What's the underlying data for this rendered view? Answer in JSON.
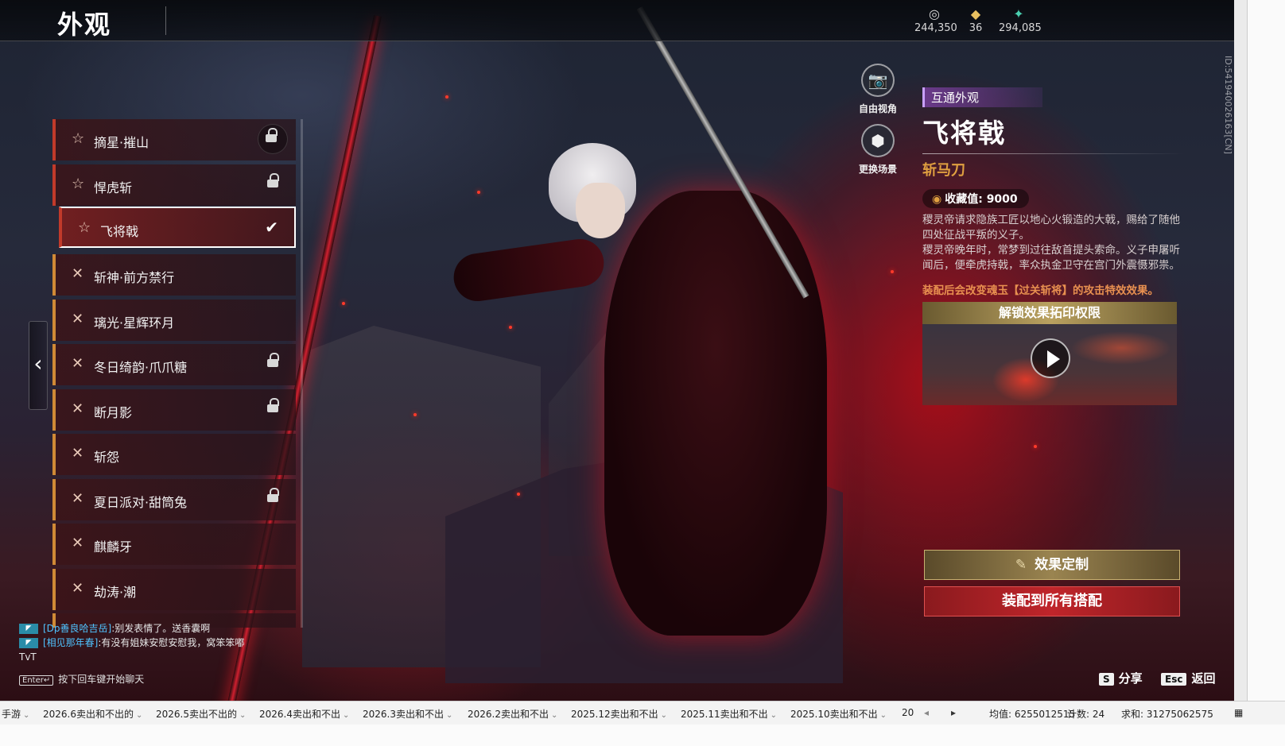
{
  "header": {
    "title": "外观",
    "currencies": [
      {
        "icon": "silver-coin-icon",
        "value": "244,350"
      },
      {
        "icon": "gold-ingot-icon",
        "value": "36"
      },
      {
        "icon": "jade-feather-icon",
        "value": "294,085"
      }
    ]
  },
  "list": {
    "items": [
      {
        "label": "摘星·摧山",
        "icon": "star",
        "locked": true,
        "accent": "red"
      },
      {
        "label": "悍虎斩",
        "icon": "star",
        "locked": true,
        "accent": "red"
      },
      {
        "label": "飞将戟",
        "icon": "star",
        "locked": false,
        "selected": true,
        "accent": "red"
      },
      {
        "label": "斩神·前方禁行",
        "icon": "cross",
        "locked": false,
        "accent": "orange"
      },
      {
        "label": "璃光·星辉环月",
        "icon": "cross",
        "locked": false,
        "accent": "orange"
      },
      {
        "label": "冬日绮韵·爪爪糖",
        "icon": "cross",
        "locked": true,
        "accent": "orange"
      },
      {
        "label": "断月影",
        "icon": "cross",
        "locked": true,
        "accent": "orange"
      },
      {
        "label": "斩怨",
        "icon": "cross",
        "locked": false,
        "accent": "orange"
      },
      {
        "label": "夏日派对·甜筒兔",
        "icon": "cross",
        "locked": true,
        "accent": "orange"
      },
      {
        "label": "麒麟牙",
        "icon": "cross",
        "locked": false,
        "accent": "orange"
      },
      {
        "label": "劫涛·潮",
        "icon": "cross",
        "locked": false,
        "accent": "orange"
      }
    ]
  },
  "camera": {
    "free_view": "自由视角",
    "change_scene": "更换场景"
  },
  "detail": {
    "tag": "互通外观",
    "name": "飞将戟",
    "type": "斩马刀",
    "collect_label": "收藏值: 9000",
    "desc1": "稷灵帝请求隐族工匠以地心火锻造的大戟，赐给了随他四处征战平叛的义子。",
    "desc2": "稷灵帝晚年时，常梦到过往敌首提头索命。义子申屠听闻后，便牵虎持戟，率众执金卫守在宫门外震慑邪祟。",
    "effect_note": "装配后会改变魂玉【过关斩将】的攻击特效效果。",
    "unlock": "解锁效果拓印权限"
  },
  "buttons": {
    "custom": "效果定制",
    "equip_all": "装配到所有搭配",
    "share_key": "S",
    "share": "分享",
    "back_key": "Esc",
    "back": "返回"
  },
  "chat": {
    "line1_name": "[Dp善良哈吉岳]",
    "line1_text": ":别发表情了。送香囊啊",
    "line2_name": "[相见那年春]",
    "line2_text": ":有没有姐妹安慰安慰我，窝笨笨嘟TvT",
    "enter_key": "Enter↵",
    "enter_hint": "按下回车键开始聊天"
  },
  "id_text": "ID:541940026163[CN]",
  "sheetbar": {
    "tabs": [
      "手游",
      "2026.6卖出和不出的",
      "2026.5卖出不出的",
      "2026.4卖出和不出",
      "2026.3卖出和不出",
      "2026.2卖出和不出",
      "2025.12卖出和不出",
      "2025.11卖出和不出",
      "2025.10卖出和不出",
      "20"
    ],
    "avg": "均值: 6255012515",
    "count": "计数: 24",
    "sum": "求和: 31275062575"
  },
  "colors": {
    "accent_red": "#c13a2a",
    "accent_orange": "#d08a36",
    "type_gold": "#e0a040",
    "equip_red": "#c0252a"
  }
}
